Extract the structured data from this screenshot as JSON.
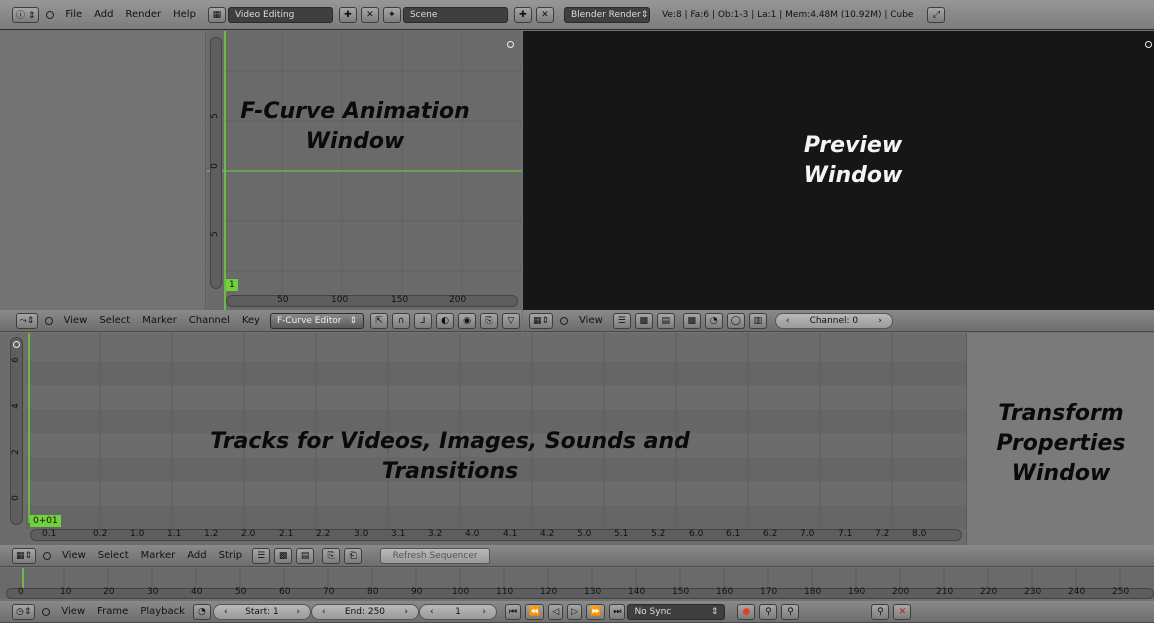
{
  "top_bar": {
    "menu": [
      "File",
      "Add",
      "Render",
      "Help"
    ],
    "screen_layout": "Video Editing",
    "scene": "Scene",
    "render_engine": "Blender Render",
    "stats": "Ve:8 | Fa:6 | Ob:1-3 | La:1 | Mem:4.48M (10.92M) | Cube"
  },
  "fcurve": {
    "overlay_line1": "F-Curve Animation",
    "overlay_line2": "Window",
    "y_ticks": [
      "5",
      "0",
      "5"
    ],
    "x_ticks": [
      "50",
      "100",
      "150",
      "200"
    ],
    "frame_badge": "1"
  },
  "preview": {
    "overlay_line1": "Preview",
    "overlay_line2": "Window"
  },
  "graph_header": {
    "menu": [
      "View",
      "Select",
      "Marker",
      "Channel",
      "Key"
    ],
    "mode": "F-Curve Editor"
  },
  "preview_header": {
    "menu": [
      "View"
    ],
    "channel": "Channel: 0"
  },
  "sequencer": {
    "overlay_line1": "Tracks for Videos, Images, Sounds and",
    "overlay_line2": "Transitions",
    "y_ticks": [
      "6",
      "4",
      "2",
      "0"
    ],
    "x_ticks": [
      "0.1",
      "0.2",
      "1.0",
      "1.1",
      "1.2",
      "2.0",
      "2.1",
      "2.2",
      "3.0",
      "3.1",
      "3.2",
      "4.0",
      "4.1",
      "4.2",
      "5.0",
      "5.1",
      "5.2",
      "6.0",
      "6.1",
      "6.2",
      "7.0",
      "7.1",
      "7.2",
      "8.0"
    ],
    "frame_badge": "0+01"
  },
  "transform": {
    "overlay_line1": "Transform",
    "overlay_line2": "Properties",
    "overlay_line3": "Window"
  },
  "sequencer_header": {
    "menu": [
      "View",
      "Select",
      "Marker",
      "Add",
      "Strip"
    ],
    "refresh": "Refresh Sequencer"
  },
  "timeline": {
    "ticks": [
      "0",
      "10",
      "20",
      "30",
      "40",
      "50",
      "60",
      "70",
      "80",
      "90",
      "100",
      "110",
      "120",
      "130",
      "140",
      "150",
      "160",
      "170",
      "180",
      "190",
      "200",
      "210",
      "220",
      "230",
      "240",
      "250"
    ]
  },
  "timeline_header": {
    "menu": [
      "View",
      "Frame",
      "Playback"
    ],
    "start": "Start: 1",
    "end": "End: 250",
    "current": "1",
    "sync": "No Sync"
  },
  "colors": {
    "accent_green": "#6fd23c",
    "preview_bg": "#161616",
    "panel_bg": "#727272"
  }
}
